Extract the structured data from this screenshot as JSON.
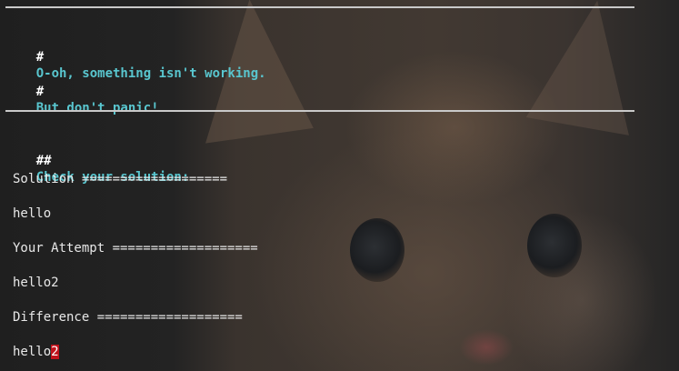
{
  "heading_marker_h1": "#",
  "heading_marker_h2": "##",
  "error_line": "O-oh, something isn't working.",
  "calm_line": "But don't panic!",
  "check_heading": "Check your solution:",
  "solution_label": "Solution ===================",
  "solution_value": "hello",
  "attempt_label": "Your Attempt ===================",
  "attempt_value": "hello2",
  "difference_label": "Difference ===================",
  "difference_common": "hello",
  "difference_extra": "2",
  "colors": {
    "heading": "#59c6cf",
    "text": "#e8e8e8",
    "rule": "#c9c9c9",
    "diff_highlight": "#c0121b"
  }
}
